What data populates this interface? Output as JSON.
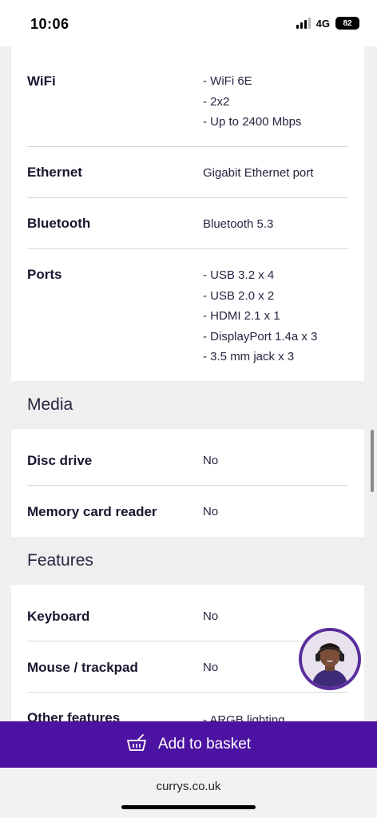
{
  "status_bar": {
    "time": "10:06",
    "network": "4G",
    "battery": "82"
  },
  "specs_connectivity": [
    {
      "label": "WiFi",
      "values": [
        "WiFi 6E",
        "2x2",
        "Up to 2400 Mbps"
      ]
    },
    {
      "label": "Ethernet",
      "value": "Gigabit Ethernet port"
    },
    {
      "label": "Bluetooth",
      "value": "Bluetooth 5.3"
    },
    {
      "label": "Ports",
      "values": [
        "USB 3.2 x 4",
        "USB 2.0 x 2",
        "HDMI 2.1 x 1",
        "DisplayPort 1.4a x 3",
        "3.5 mm jack x 3"
      ]
    }
  ],
  "media": {
    "title": "Media",
    "rows": [
      {
        "label": "Disc drive",
        "value": "No"
      },
      {
        "label": "Memory card reader",
        "value": "No"
      }
    ]
  },
  "features": {
    "title": "Features",
    "rows": [
      {
        "label": "Keyboard",
        "value": "No"
      },
      {
        "label": "Mouse / trackpad",
        "value": "No"
      },
      {
        "label": "Other features",
        "values": [
          "ARGB lighting"
        ]
      }
    ]
  },
  "basket": {
    "label": "Add to basket"
  },
  "browser": {
    "url": "currys.co.uk"
  },
  "colors": {
    "brand_purple": "#4c12a1",
    "section_bg": "#efeff0",
    "text": "#1b1530"
  },
  "icons": {
    "basket": "basket-icon",
    "support": "support-agent-avatar"
  }
}
